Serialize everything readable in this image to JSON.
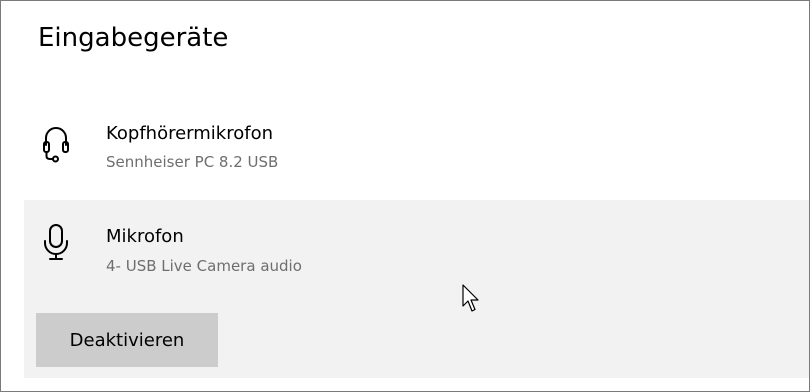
{
  "section": {
    "title": "Eingabegeräte"
  },
  "devices": [
    {
      "name": "Kopfhörermikrofon",
      "subtitle": "Sennheiser PC 8.2 USB",
      "icon": "headset-icon"
    },
    {
      "name": "Mikrofon",
      "subtitle": "4- USB Live Camera audio",
      "icon": "microphone-icon",
      "selected": true,
      "action_label": "Deaktivieren"
    }
  ],
  "colors": {
    "selected_background": "#f2f2f2",
    "button_background": "#cccccc",
    "secondary_text": "#6e6e6e"
  }
}
